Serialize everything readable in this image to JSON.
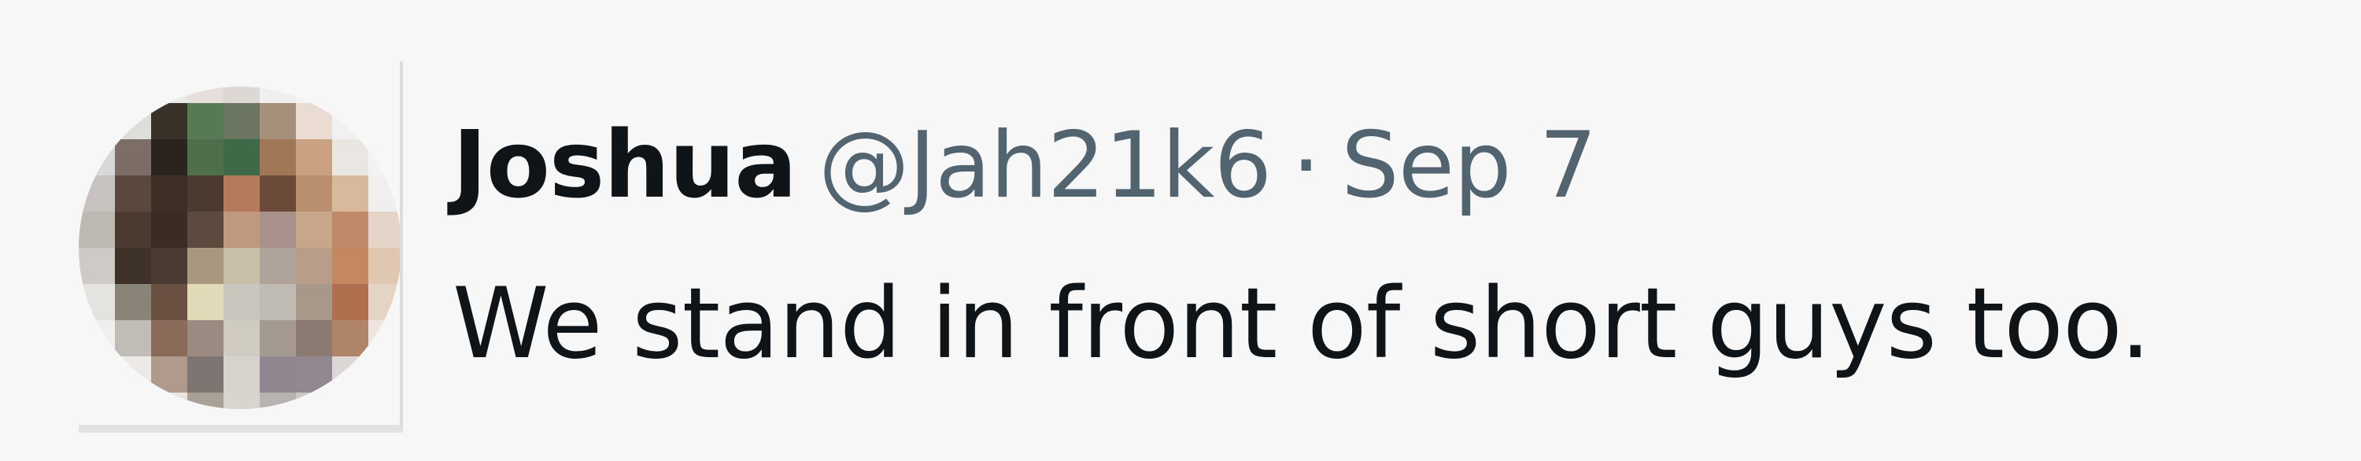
{
  "tweet": {
    "display_name": "Joshua",
    "handle": "@Jah21k6",
    "separator": "·",
    "date": "Sep 7",
    "text": "We stand in front of short guys too."
  },
  "avatar": {
    "style": "pixelated-blurred",
    "colors": [
      "#3b2d26",
      "#5a7a5a",
      "#c08a6a",
      "#d8c9b8",
      "#9c8e88",
      "#e8e0da"
    ]
  },
  "colors": {
    "background": "#f7f7f7",
    "name": "#0f1419",
    "secondary": "#536471",
    "body_text": "#0f1419"
  }
}
